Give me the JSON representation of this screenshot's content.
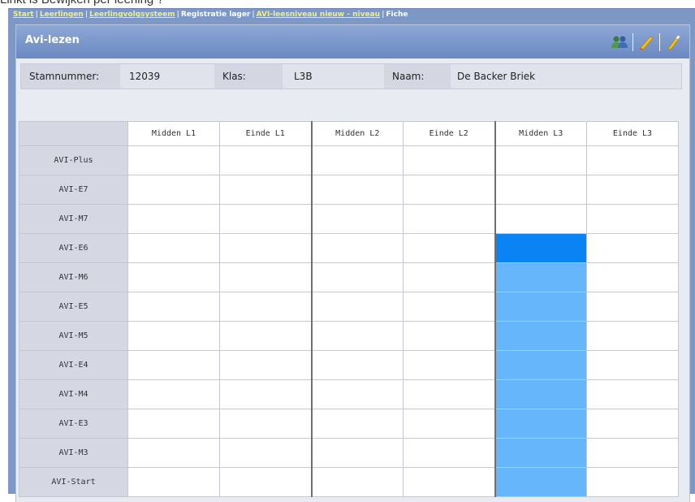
{
  "caption": "Linkt is Bewijken per leerling ?",
  "breadcrumb": [
    {
      "label": "Start",
      "link": true
    },
    {
      "label": "Leerlingen",
      "link": true
    },
    {
      "label": "Leerlingvolgsysteem",
      "link": true
    },
    {
      "label": "Registratie lager",
      "link": false
    },
    {
      "label": "AVI-leesniveau nieuw - niveau",
      "link": true
    },
    {
      "label": "Fiche",
      "link": false
    }
  ],
  "panel": {
    "title": "Avi-lezen",
    "toolbar": [
      {
        "name": "users-icon"
      },
      {
        "name": "pencil-icon"
      },
      {
        "name": "eraser-icon"
      }
    ]
  },
  "student": {
    "stamnummer_label": "Stamnummer:",
    "stamnummer": "12039",
    "klas_label": "Klas:",
    "klas": "L3B",
    "naam_label": "Naam:",
    "naam": "De Backer Briek"
  },
  "grid": {
    "columns": [
      "Midden L1",
      "Einde L1",
      "Midden L2",
      "Einde L2",
      "Midden L3",
      "Einde L3"
    ],
    "rows": [
      "AVI-Plus",
      "AVI-E7",
      "AVI-M7",
      "AVI-E6",
      "AVI-M6",
      "AVI-E5",
      "AVI-M5",
      "AVI-E4",
      "AVI-M4",
      "AVI-E3",
      "AVI-M3",
      "AVI-Start"
    ],
    "achieved": {
      "column": "Midden L3",
      "level": "AVI-E6"
    }
  },
  "colors": {
    "header": "#6a89c1",
    "achieved_level": "#0a84f5",
    "below_level": "#66b6fb"
  }
}
